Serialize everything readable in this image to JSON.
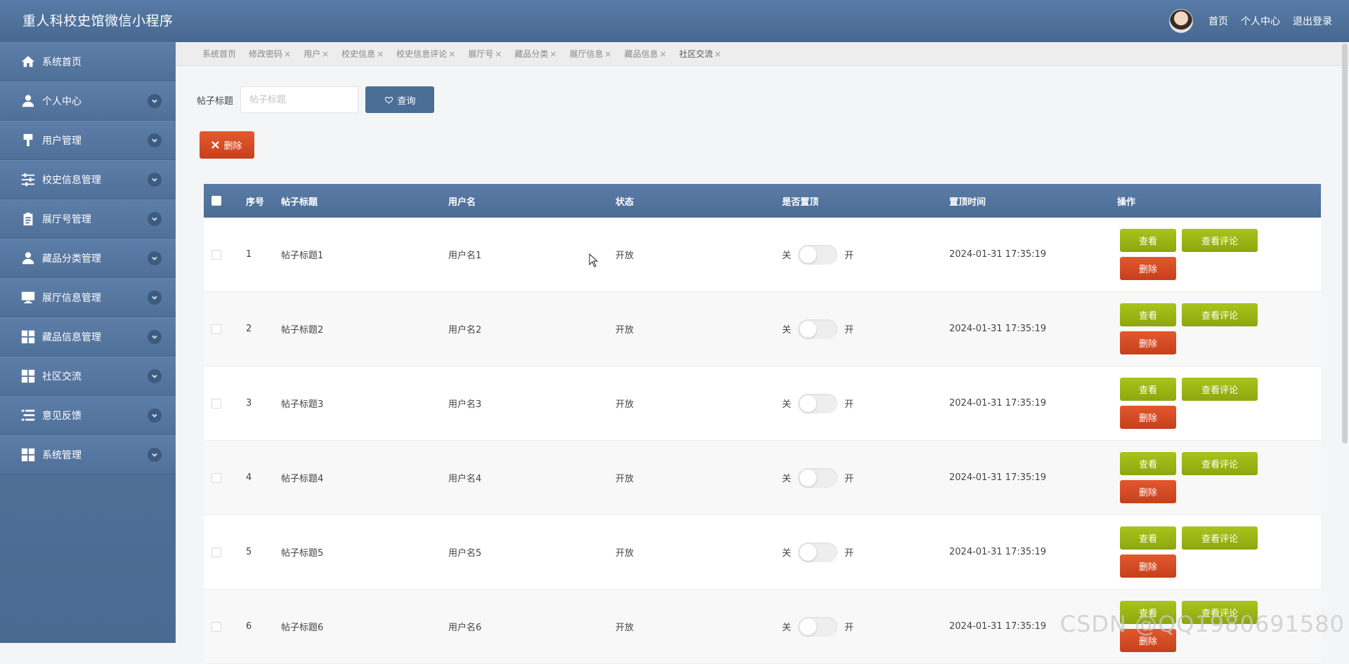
{
  "header": {
    "title": "重人科校史馆微信小程序",
    "links": [
      "首页",
      "个人中心",
      "退出登录"
    ]
  },
  "sidebar": {
    "items": [
      {
        "label": "系统首页",
        "icon": "home-icon",
        "has_arrow": false
      },
      {
        "label": "个人中心",
        "icon": "person-icon",
        "has_arrow": true
      },
      {
        "label": "用户管理",
        "icon": "brush-icon",
        "has_arrow": true
      },
      {
        "label": "校史信息管理",
        "icon": "sliders-icon",
        "has_arrow": true
      },
      {
        "label": "展厅号管理",
        "icon": "clipboard-icon",
        "has_arrow": true
      },
      {
        "label": "藏品分类管理",
        "icon": "person-icon",
        "has_arrow": true
      },
      {
        "label": "展厅信息管理",
        "icon": "monitor-icon",
        "has_arrow": true
      },
      {
        "label": "藏品信息管理",
        "icon": "grid-icon",
        "has_arrow": true
      },
      {
        "label": "社区交流",
        "icon": "grid-icon",
        "has_arrow": true
      },
      {
        "label": "意见反馈",
        "icon": "list-icon",
        "has_arrow": true
      },
      {
        "label": "系统管理",
        "icon": "grid-icon",
        "has_arrow": true
      }
    ]
  },
  "tabs": [
    {
      "label": "系统首页",
      "closable": false
    },
    {
      "label": "修改密码",
      "closable": true
    },
    {
      "label": "用户",
      "closable": true
    },
    {
      "label": "校史信息",
      "closable": true
    },
    {
      "label": "校史信息评论",
      "closable": true
    },
    {
      "label": "展厅号",
      "closable": true
    },
    {
      "label": "藏品分类",
      "closable": true
    },
    {
      "label": "展厅信息",
      "closable": true
    },
    {
      "label": "藏品信息",
      "closable": true
    },
    {
      "label": "社区交流",
      "closable": true,
      "active": true
    }
  ],
  "tab_close_glyph": "×",
  "search": {
    "label": "帖子标题",
    "placeholder": "帖子标题",
    "value": "",
    "button_label": "查询"
  },
  "toolbar": {
    "delete_label": "删除"
  },
  "table": {
    "columns": [
      "序号",
      "帖子标题",
      "用户名",
      "状态",
      "是否置顶",
      "置顶时间",
      "操作"
    ],
    "toggle_off_label": "关",
    "toggle_on_label": "开",
    "actions": {
      "view": "查看",
      "comments": "查看评论",
      "delete": "删除"
    },
    "rows": [
      {
        "index": "1",
        "title": "帖子标题1",
        "username": "用户名1",
        "status": "开放",
        "pinned": false,
        "time": "2024-01-31 17:35:19"
      },
      {
        "index": "2",
        "title": "帖子标题2",
        "username": "用户名2",
        "status": "开放",
        "pinned": false,
        "time": "2024-01-31 17:35:19"
      },
      {
        "index": "3",
        "title": "帖子标题3",
        "username": "用户名3",
        "status": "开放",
        "pinned": false,
        "time": "2024-01-31 17:35:19"
      },
      {
        "index": "4",
        "title": "帖子标题4",
        "username": "用户名4",
        "status": "开放",
        "pinned": false,
        "time": "2024-01-31 17:35:19"
      },
      {
        "index": "5",
        "title": "帖子标题5",
        "username": "用户名5",
        "status": "开放",
        "pinned": false,
        "time": "2024-01-31 17:35:19"
      },
      {
        "index": "6",
        "title": "帖子标题6",
        "username": "用户名6",
        "status": "开放",
        "pinned": false,
        "time": "2024-01-31 17:35:19"
      }
    ]
  },
  "watermark": "CSDN @QQ1980691580",
  "colors": {
    "header": "#4f6f97",
    "view_button": "#9bb516",
    "delete_button": "#d64a22"
  }
}
